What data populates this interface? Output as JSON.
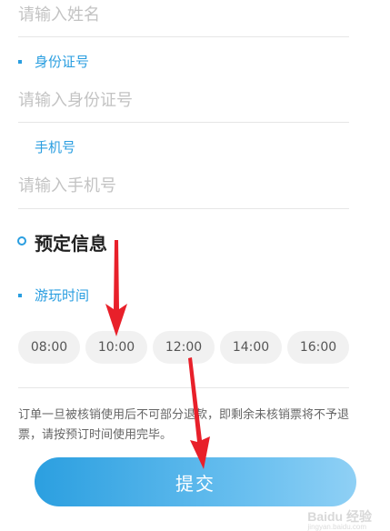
{
  "name_field": {
    "placeholder": "请输入姓名"
  },
  "id_field": {
    "label": "身份证号",
    "placeholder": "请输入身份证号"
  },
  "phone_field": {
    "label": "手机号",
    "placeholder": "请输入手机号"
  },
  "booking": {
    "section_title": "预定信息",
    "time_label": "游玩时间",
    "time_slots": [
      "08:00",
      "10:00",
      "12:00",
      "14:00",
      "16:00"
    ]
  },
  "notice": "订单一旦被核销使用后不可部分退款，即剩余未核销票将不予退票，请按预订时间使用完毕。",
  "submit_label": "提交",
  "watermark": {
    "brand": "Baidu 经验",
    "url": "jingyan.baidu.com"
  },
  "colors": {
    "accent": "#2a9ee0",
    "arrow": "#e8202a"
  }
}
